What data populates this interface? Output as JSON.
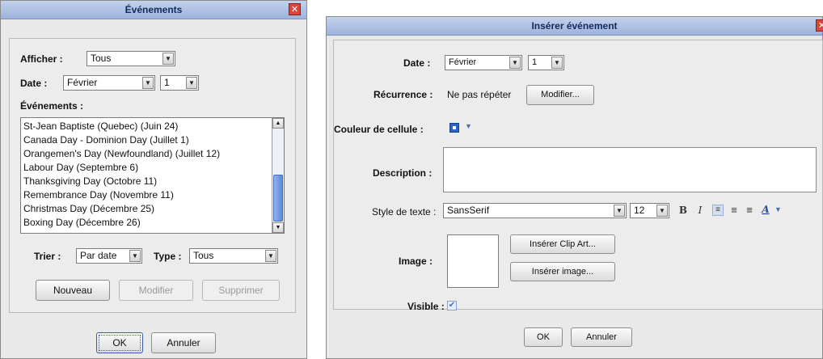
{
  "events_dialog": {
    "title": "Événements",
    "close": "✕",
    "show_label": "Afficher :",
    "show_value": "Tous",
    "date_label": "Date :",
    "month_value": "Février",
    "day_value": "1",
    "events_label": "Événements :",
    "events": [
      "St-Jean Baptiste (Quebec) (Juin 24)",
      "Canada Day - Dominion Day (Juillet 1)",
      "Orangemen's Day (Newfoundland) (Juillet 12)",
      "Labour Day (Septembre 6)",
      "Thanksgiving Day (Octobre 11)",
      "Remembrance Day (Novembre 11)",
      "Christmas Day (Décembre 25)",
      "Boxing Day (Décembre 26)"
    ],
    "sort_label": "Trier :",
    "sort_value": "Par date",
    "type_label": "Type :",
    "type_value": "Tous",
    "new_button": "Nouveau",
    "edit_button": "Modifier",
    "delete_button": "Supprimer",
    "ok_button": "OK",
    "cancel_button": "Annuler"
  },
  "insert_dialog": {
    "title": "Insérer événement",
    "close": "✕",
    "date_label": "Date :",
    "month_value": "Février",
    "day_value": "1",
    "recurrence_label": "Récurrence :",
    "recurrence_value": "Ne pas répéter",
    "modify_button": "Modifier...",
    "cell_color_label": "Couleur de cellule :",
    "description_label": "Description :",
    "text_style_label": "Style de texte :",
    "font_value": "SansSerif",
    "size_value": "12",
    "bold_glyph": "B",
    "italic_glyph": "I",
    "font_color_glyph": "A",
    "image_label": "Image :",
    "insert_clipart_button": "Insérer Clip Art...",
    "insert_image_button": "Insérer image...",
    "visible_label": "Visible :",
    "ok_button": "OK",
    "cancel_button": "Annuler"
  },
  "colors": {
    "titlebar": "#9db3dc",
    "close": "#d9473b",
    "scroll_thumb": "#5f89d8",
    "swatch": "#2a66c9"
  }
}
